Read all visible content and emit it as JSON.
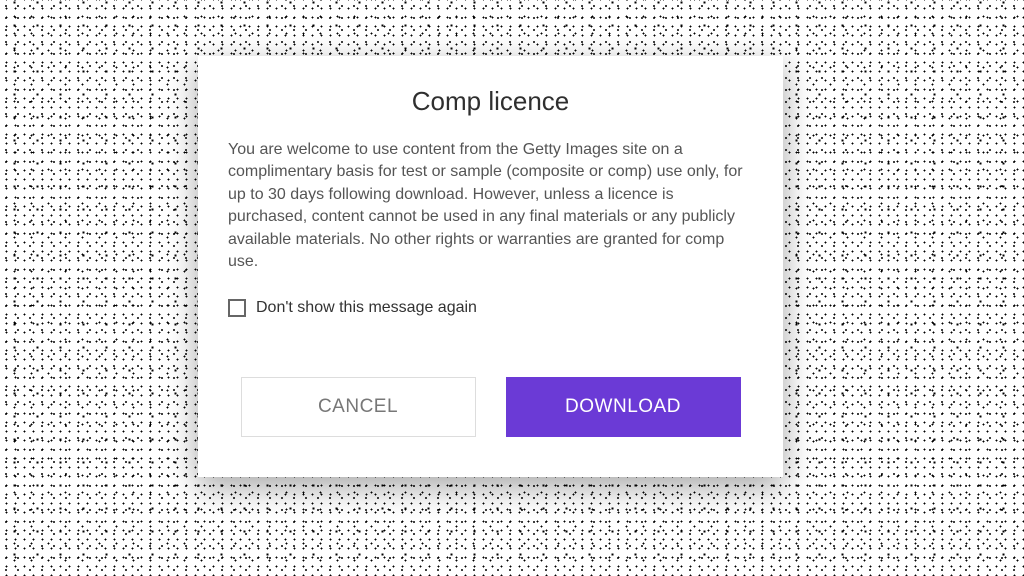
{
  "modal": {
    "title": "Comp licence",
    "body_text": "You are welcome to use content from the Getty Images site on a complimentary basis for test or sample (composite or comp) use only, for up to 30 days following download. However, unless a licence is purchased, content cannot be used in any final materials or any publicly available materials. No other rights or warranties are granted for comp use.",
    "dont_show_label": "Don't show this message again",
    "dont_show_checked": false,
    "buttons": {
      "cancel": "CANCEL",
      "download": "DOWNLOAD"
    }
  },
  "colors": {
    "primary": "#6b3ad6"
  }
}
